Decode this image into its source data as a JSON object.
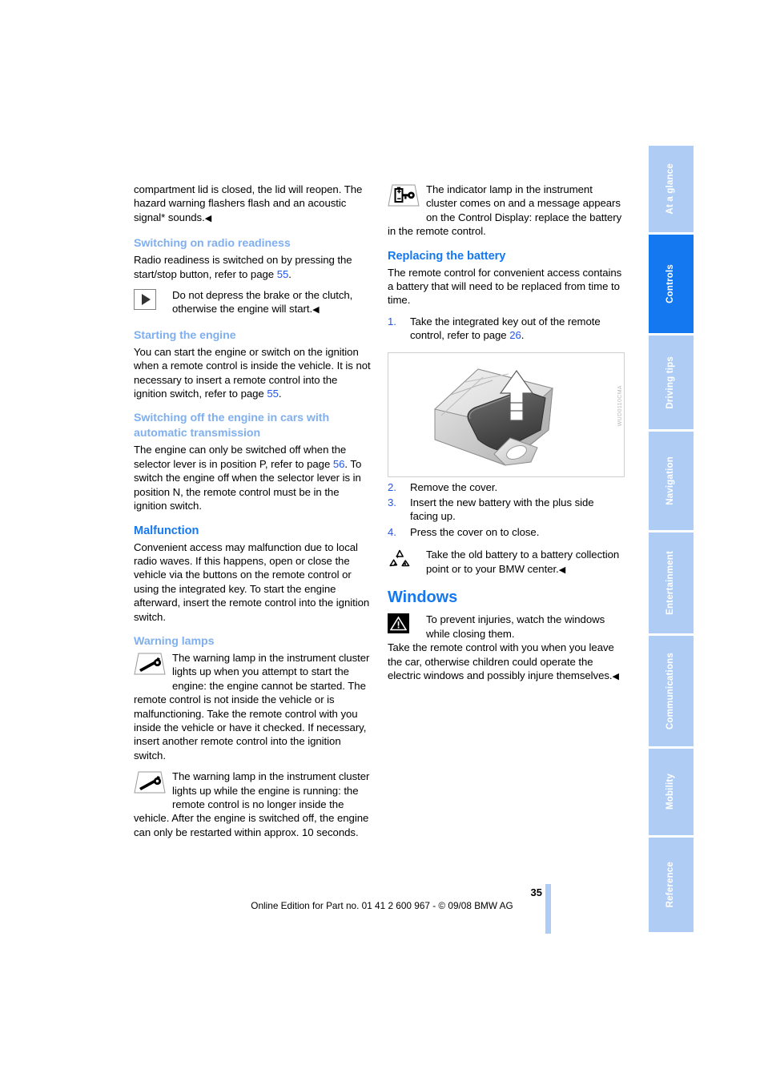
{
  "document": {
    "page_number": "35",
    "footer_text": "Online Edition for Part no. 01 41 2 600 967  - © 09/08 BMW AG"
  },
  "colors": {
    "heading_strong": "#1478F0",
    "heading_light": "#7FAFEF",
    "page_reference": "#2255EE",
    "tab_inactive": "#AFCDF4",
    "tab_active": "#1478F0"
  },
  "tabs": [
    {
      "label": "At a glance",
      "active": false
    },
    {
      "label": "Controls",
      "active": true
    },
    {
      "label": "Driving tips",
      "active": false
    },
    {
      "label": "Navigation",
      "active": false
    },
    {
      "label": "Entertainment",
      "active": false
    },
    {
      "label": "Communications",
      "active": false
    },
    {
      "label": "Mobility",
      "active": false
    },
    {
      "label": "Reference",
      "active": false
    }
  ],
  "left_column": {
    "continued_paragraph": "compartment lid is closed, the lid will reopen. The hazard warning flashers flash and an acoustic signal* sounds.",
    "section_radio_readiness": {
      "heading": "Switching on radio readiness",
      "paragraph_pre": "Radio readiness is switched on by pressing the start/stop button, refer to page ",
      "page_ref": "55",
      "paragraph_post": ".",
      "note_icon": "play-triangle-icon",
      "note_text": "Do not depress the brake or the clutch, otherwise the engine will start."
    },
    "section_starting_engine": {
      "heading": "Starting the engine",
      "paragraph_pre": "You can start the engine or switch on the ignition when a remote control is inside the vehicle. It is not necessary to insert a remote control into the ignition switch, refer to page ",
      "page_ref": "55",
      "paragraph_post": "."
    },
    "section_switching_off": {
      "heading": "Switching off the engine in cars with automatic transmission",
      "paragraph_pre": "The engine can only be switched off when the selector lever is in position P, refer to page ",
      "page_ref": "56",
      "paragraph_post": ". To switch the engine off when the selector lever is in position N, the remote control must be in the ignition switch."
    },
    "section_malfunction": {
      "heading": "Malfunction",
      "paragraph": "Convenient access may malfunction due to local radio waves. If this happens, open or close the vehicle via the buttons on the remote control or using the integrated key. To start the engine afterward, insert the remote control into the ignition switch."
    },
    "section_warning_lamps": {
      "heading": "Warning lamps",
      "note_1_icon": "warning-lamp-key-icon",
      "note_1_text": "The warning lamp in the instrument cluster lights up when you attempt to start the engine: the engine cannot be started. The remote control is not inside the vehicle or is malfunctioning. Take the remote control with you inside the vehicle or have it checked. If necessary, insert another remote control into the ignition switch.",
      "note_2_icon": "warning-lamp-key-icon",
      "note_2_text": "The warning lamp in the instrument cluster lights up while the engine is running: the remote control is no longer inside the vehicle. After the engine is switched off, the engine can only be restarted within approx. 10 seconds."
    }
  },
  "right_column": {
    "indicator_note": {
      "icon": "battery-key-indicator-icon",
      "text": "The indicator lamp in the instrument cluster comes on and a message appears on the Control Display: replace the battery in the remote control."
    },
    "section_replacing_battery": {
      "heading": "Replacing the battery",
      "paragraph": "The remote control for convenient access contains a battery that will need to be replaced from time to time.",
      "steps_before_figure": [
        {
          "num": "1.",
          "text_pre": "Take the integrated key out of the remote control, refer to page ",
          "page_ref": "26",
          "text_post": "."
        }
      ],
      "figure": {
        "alt": "remote-control-cover-removal-illustration",
        "code": "WUD0110CMA"
      },
      "steps_after_figure": [
        {
          "num": "2.",
          "text": "Remove the cover."
        },
        {
          "num": "3.",
          "text": "Insert the new battery with the plus side facing up."
        },
        {
          "num": "4.",
          "text": "Press the cover on to close."
        }
      ],
      "recycle_note": {
        "icon": "recycle-icon",
        "text": "Take the old battery to a battery collection point or to your BMW center."
      }
    },
    "section_windows": {
      "heading": "Windows",
      "warning_icon": "warning-triangle-icon",
      "warning_text": "To prevent injuries, watch the windows while closing them.",
      "paragraph": "Take the remote control with you when you leave the car, otherwise children could operate the electric windows and possibly injure themselves."
    }
  }
}
